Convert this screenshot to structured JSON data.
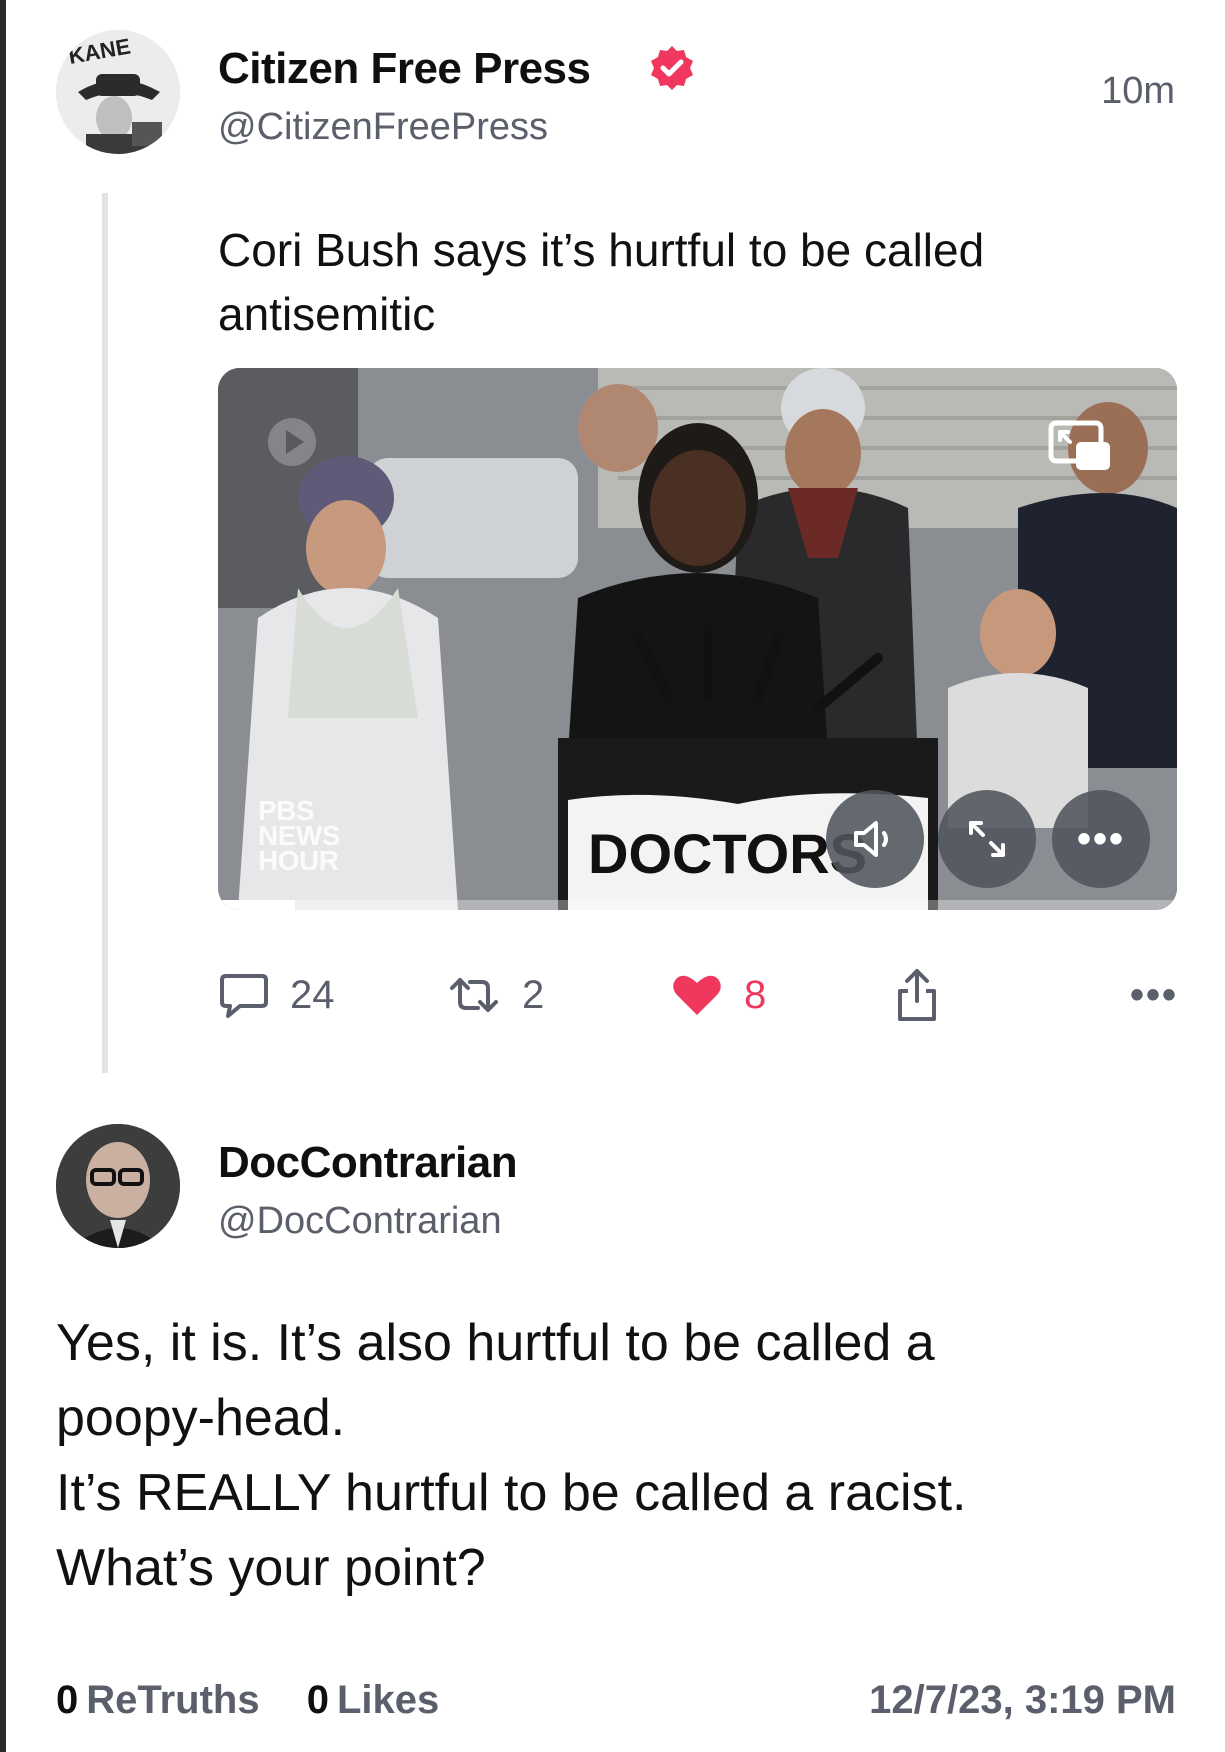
{
  "quoted_post": {
    "display_name": "Citizen Free Press",
    "handle": "@CitizenFreePress",
    "timestamp": "10m",
    "text_lines": [
      "Cori Bush says it’s hurtful to be called",
      "antisemitic"
    ],
    "video": {
      "broadcaster_logo": [
        "PBS",
        "NEWS",
        "HOUR"
      ],
      "podium_sign": "DOCTORS",
      "progress": 0.08
    },
    "actions": {
      "replies": "24",
      "retruths": "2",
      "likes": "8"
    },
    "avatar_text": "KANE"
  },
  "post": {
    "display_name": "DocContrarian",
    "handle": "@DocContrarian",
    "text_lines": [
      "Yes, it is. It’s also hurtful to be called a",
      "poopy-head.",
      "It’s REALLY hurtful to be called a racist.",
      "What’s your point?"
    ],
    "retruths_count": "0",
    "retruths_label": "ReTruths",
    "likes_count": "0",
    "likes_label": "Likes",
    "date": "12/7/23, 3:19 PM"
  },
  "colors": {
    "verified_badge": "#f0375d",
    "like_active": "#f0375d",
    "muted_text": "#5b5f6b",
    "thread_line": "#e2e3e7"
  },
  "icons": [
    "verified-badge-icon",
    "picture-in-picture-icon",
    "play-icon",
    "volume-icon",
    "expand-icon",
    "more-icon",
    "reply-icon",
    "retruth-icon",
    "heart-icon",
    "share-icon"
  ]
}
